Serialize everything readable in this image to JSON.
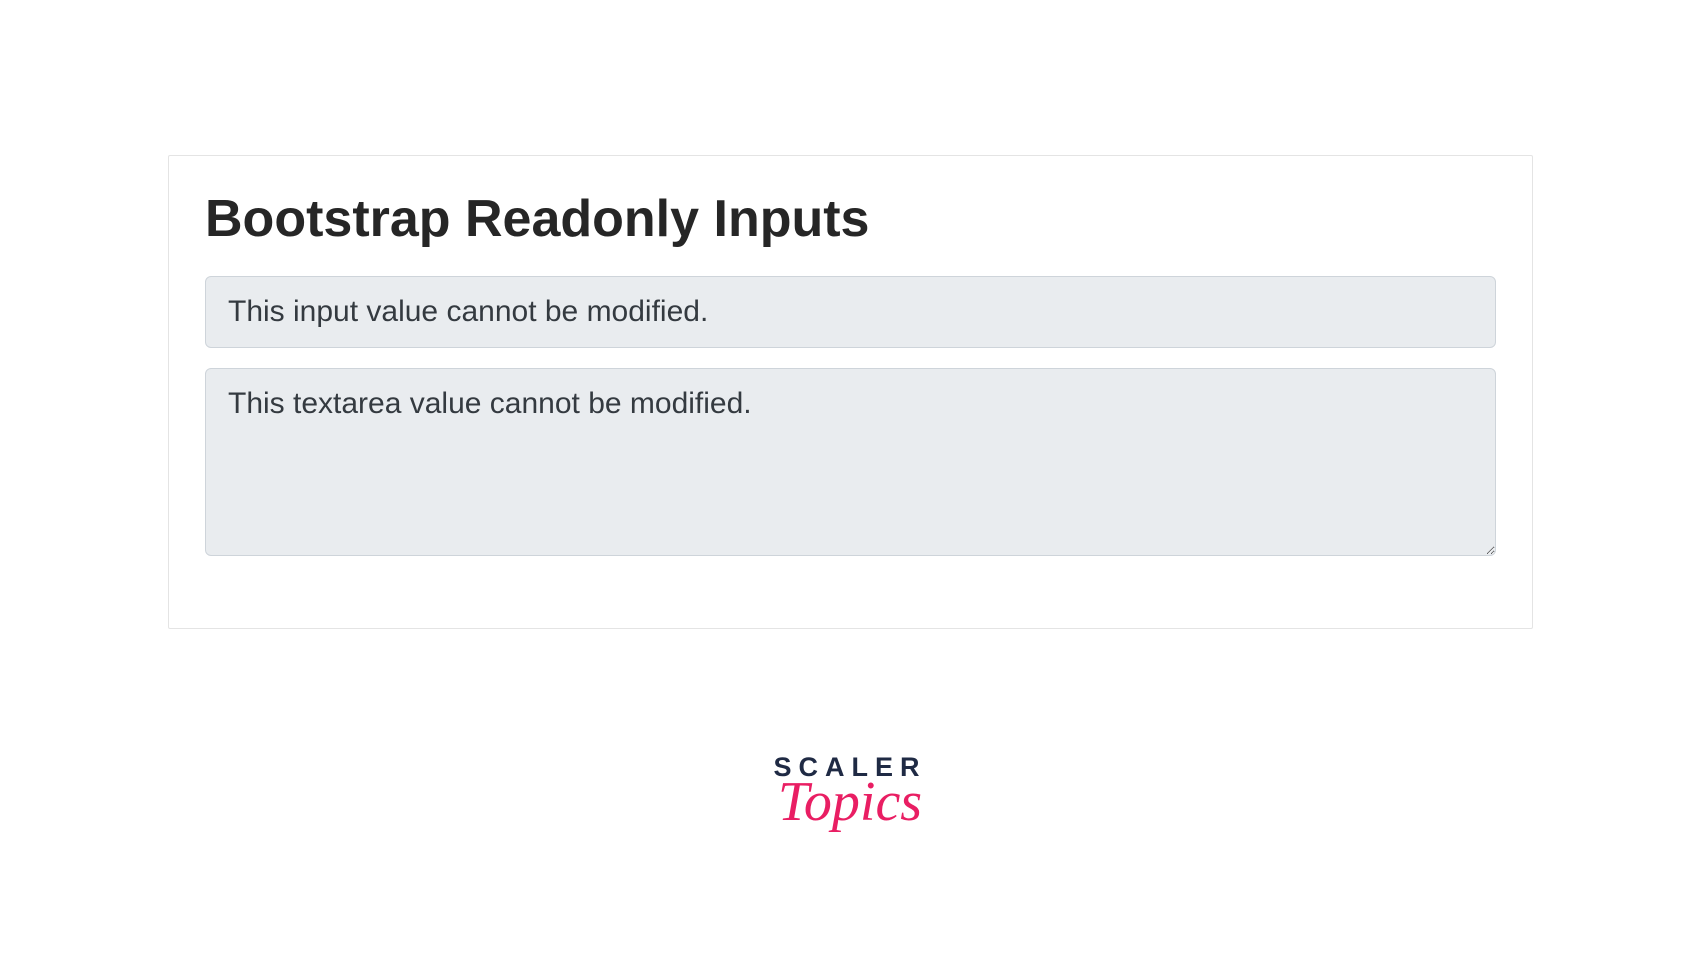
{
  "panel": {
    "heading": "Bootstrap Readonly Inputs",
    "input_value": "This input value cannot be modified.",
    "textarea_value": "This textarea value cannot be modified."
  },
  "logo": {
    "line1": "SCALER",
    "line2": "Topics"
  }
}
